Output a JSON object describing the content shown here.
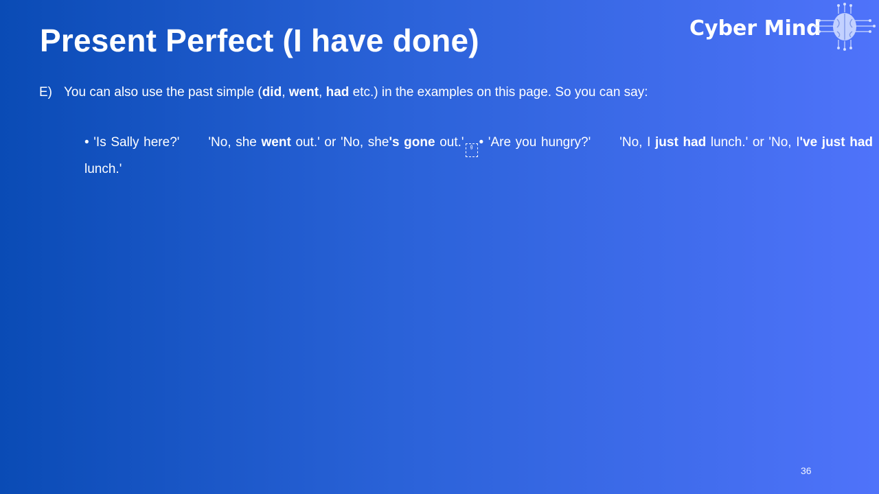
{
  "slide": {
    "title": "Present Perfect (I have done)",
    "logo": {
      "text": "Cyber Mind",
      "icon": "brain-circuit-icon"
    },
    "intro": {
      "marker": "E)",
      "t1": "You can also use the past simple (",
      "b1": "did",
      "t2": ", ",
      "b2": "went",
      "t3": ", ",
      "b3": "had",
      "t4": " etc.) in the examples on this page. So you can say:"
    },
    "example": {
      "bullet1": "• 'Is Sally here?'",
      "a1": "'No, she ",
      "a1b": "went",
      "a2": " out.' or 'No, she",
      "a2b": "'s gone",
      "a3": " out.'",
      "sep_icon": "separator-glyph-icon",
      "bullet2": "• 'Are you hungry?'",
      "c1": "'No, I ",
      "c1b": "just had",
      "c2": " lunch.' or 'No, I",
      "c2b": "'ve just had",
      "c3": " lunch.'"
    },
    "page_number": "36"
  }
}
